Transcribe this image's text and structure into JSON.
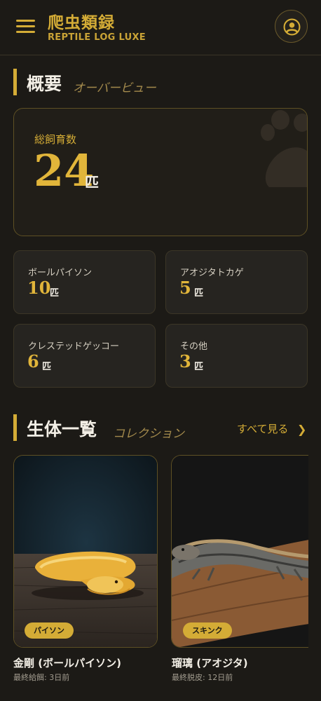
{
  "header": {
    "title": "爬虫類録",
    "subtitle": "REPTILE LOG LUXE",
    "menu_icon": "hamburger-menu-icon",
    "profile_icon": "user-circle-icon"
  },
  "overview": {
    "title": "概要",
    "subtitle": "オーバービュー",
    "total": {
      "label": "総飼育数",
      "count": "24",
      "unit": "匹"
    },
    "species": [
      {
        "name": "ボールパイソン",
        "count": "10",
        "unit": "匹"
      },
      {
        "name": "アオジタトカゲ",
        "count": "5",
        "unit": "匹"
      },
      {
        "name": "クレステッドゲッコー",
        "count": "6",
        "unit": "匹"
      },
      {
        "name": "その他",
        "count": "3",
        "unit": "匹"
      }
    ]
  },
  "collection": {
    "title": "生体一覧",
    "subtitle": "コレクション",
    "see_all": "すべて見る",
    "items": [
      {
        "tag": "パイソン",
        "name": "金剛 (ボールパイソン)",
        "meta": "最終給餌: 3日前"
      },
      {
        "tag": "スキンク",
        "name": "瑠璃 (アオジタ)",
        "meta": "最終脱皮: 12日前"
      }
    ]
  },
  "colors": {
    "accent": "#d4ac36",
    "background": "#1c1a16",
    "card": "#262420"
  }
}
